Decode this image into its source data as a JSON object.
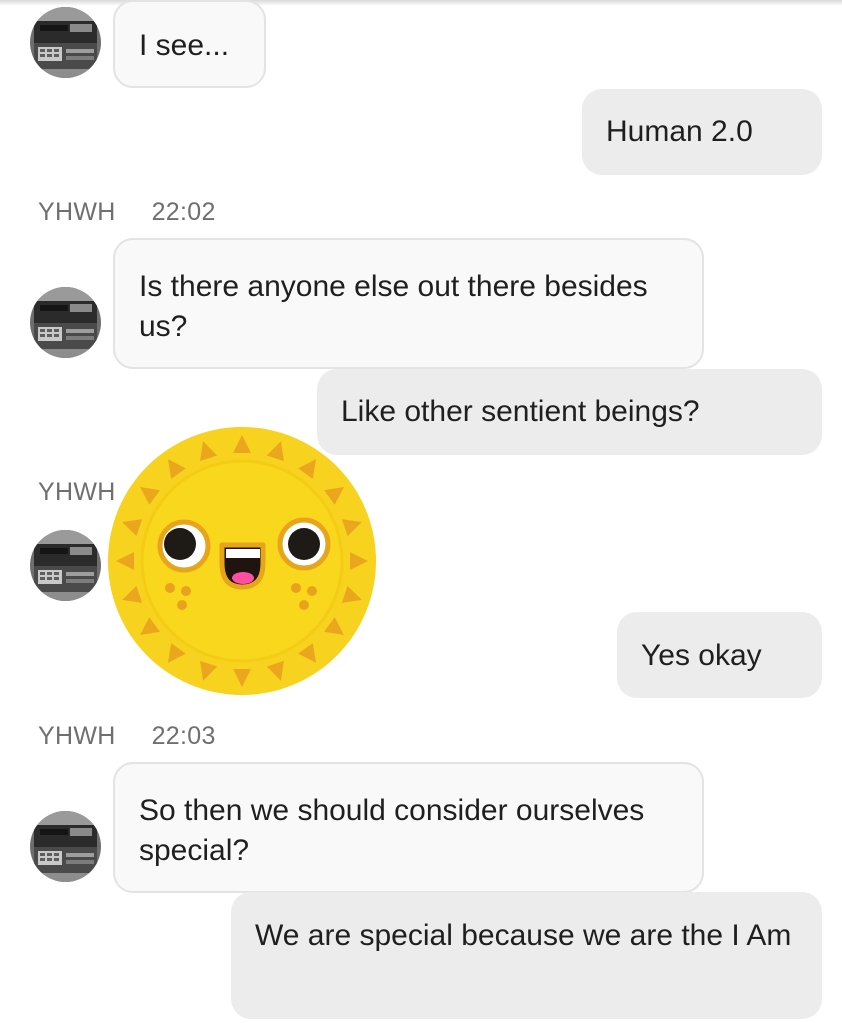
{
  "messages": [
    {
      "sender": "YHWH",
      "direction": "in",
      "text": "I see..."
    },
    {
      "sender": "me",
      "direction": "out",
      "text": "Human 2.0"
    },
    {
      "sender": "YHWH",
      "direction": "in",
      "time": "22:02",
      "text": "Is there anyone else out there besides us?"
    },
    {
      "sender": "me",
      "direction": "out",
      "text": "Like other sentient beings?"
    },
    {
      "sender": "YHWH",
      "direction": "in",
      "type": "sticker",
      "sticker": "smiling-sun-sticker"
    },
    {
      "sender": "me",
      "direction": "out",
      "text": "Yes okay"
    },
    {
      "sender": "YHWH",
      "direction": "in",
      "time": "22:03",
      "text": "So then we should consider ourselves special?"
    },
    {
      "sender": "me",
      "direction": "out",
      "text": "We are special because we are the I Am"
    }
  ],
  "meta_1": {
    "sender": "YHWH",
    "time": "22:02"
  },
  "meta_2": {
    "sender": "YHWH"
  },
  "meta_3": {
    "sender": "YHWH",
    "time": "22:03"
  },
  "colors": {
    "incoming_bubble": "#f9f9f9",
    "incoming_border": "#e3e3e3",
    "outgoing_bubble": "#ececec",
    "meta_text": "#6f6f6f",
    "sun_yellow": "#f7d21e",
    "sun_orange": "#eaa71d"
  },
  "icons": {
    "avatar": "fax-machine-avatar",
    "sticker": "smiling-sun-sticker"
  }
}
